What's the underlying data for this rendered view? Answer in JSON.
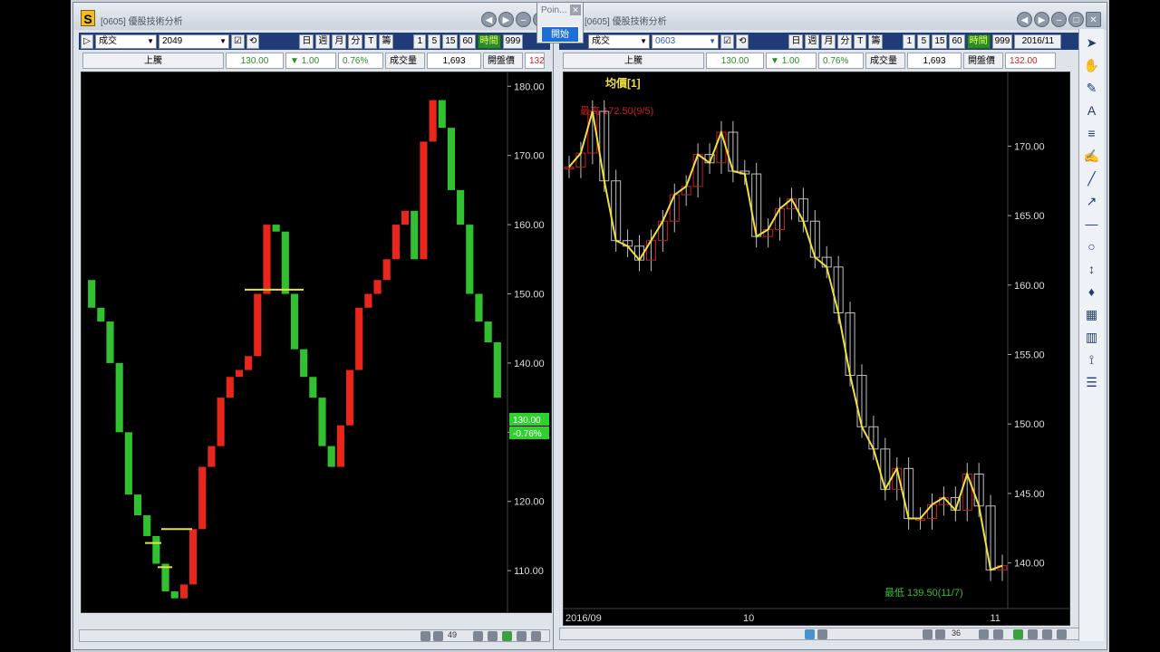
{
  "left_window": {
    "title": "[0605] 優股技術分析",
    "app_icon": "S",
    "period_select": "成交",
    "count_select": "2049",
    "toolbar_buttons": [
      "日",
      "週",
      "月",
      "分",
      "T",
      "籌",
      "1",
      "5",
      "15",
      "60",
      "時間",
      "999"
    ],
    "quote": {
      "name": "上騰",
      "price": "130.00",
      "change": "1.00",
      "change_pct": "0.76%",
      "volume_label": "成交量",
      "volume": "1,693",
      "open_label": "開盤價",
      "open": "132"
    },
    "price_axis": [
      "180.00",
      "170.00",
      "160.00",
      "150.00",
      "140.00",
      "130.00",
      "120.00",
      "110.00"
    ],
    "last_price_tag": "130.00",
    "last_change_tag": "-0.76%",
    "scroll_value": "49"
  },
  "right_window": {
    "title": "[0605] 優股技術分析",
    "period_select": "成交",
    "count_select": "0603",
    "toolbar_buttons": [
      "日",
      "週",
      "月",
      "分",
      "T",
      "籌",
      "1",
      "5",
      "15",
      "60",
      "時間",
      "999"
    ],
    "date_field": "2016/11",
    "quote": {
      "name": "上騰",
      "price": "130.00",
      "change": "1.00",
      "change_pct": "0.76%",
      "volume_label": "成交量",
      "volume": "1,693",
      "open_label": "開盤價",
      "open": "132.00"
    },
    "indicator_label": "均價[1]",
    "high_label": "最高 172.50(9/5)",
    "low_label": "最低 139.50(11/7)",
    "price_axis": [
      "170.00",
      "165.00",
      "160.00",
      "155.00",
      "150.00",
      "145.00",
      "140.00"
    ],
    "date_axis": [
      "2016/09",
      "10",
      "11"
    ],
    "scroll_value": "36"
  },
  "popup": {
    "title": "Poin...",
    "button": "開始"
  },
  "side_tools": [
    "cursor-icon",
    "hand-icon",
    "pencil-icon",
    "text-icon",
    "lines-icon",
    "draw-icon",
    "line-icon",
    "ray-icon",
    "hline-icon",
    "circle-icon",
    "arrow-icon",
    "marker-icon",
    "grid-icon",
    "bars-icon",
    "fan-icon",
    "channel-icon"
  ],
  "chart_data": [
    {
      "type": "line",
      "title": "",
      "ylim": [
        104,
        182
      ],
      "series": [
        {
          "values": [
            152,
            148,
            146,
            140,
            130,
            121,
            118,
            115,
            111,
            107,
            106,
            108,
            116,
            125,
            128,
            135,
            138,
            139,
            141,
            150,
            160,
            159,
            150,
            142,
            138,
            135,
            128,
            125,
            131,
            139,
            148,
            150,
            152,
            155,
            160,
            162,
            155,
            172,
            178,
            174,
            165,
            160,
            150,
            146,
            143,
            135
          ]
        }
      ],
      "colors": {
        "up": "#e8261c",
        "down": "#30c030",
        "marker": "#e8e040"
      }
    },
    {
      "type": "line",
      "title": "",
      "ylim": [
        137.5,
        174
      ],
      "x_ticks": [
        "2016/09",
        "10",
        "11"
      ],
      "series": [
        {
          "values": [
            168.5,
            169.5,
            172.5,
            167.5,
            163.2,
            162.8,
            161.8,
            163.2,
            164.6,
            166.5,
            167.1,
            169.4,
            168.8,
            171.0,
            168.2,
            168.0,
            163.5,
            164.0,
            165.5,
            166.2,
            164.6,
            162.0,
            161.3,
            158.0,
            153.5,
            149.8,
            148.2,
            145.3,
            146.8,
            143.2,
            143.2,
            144.2,
            144.7,
            143.8,
            146.4,
            144.1,
            139.5,
            139.8
          ]
        }
      ],
      "colors": {
        "line": "#f0e040",
        "candle_outline": "#bfbfbf",
        "candle_down": "#c82020"
      }
    }
  ]
}
